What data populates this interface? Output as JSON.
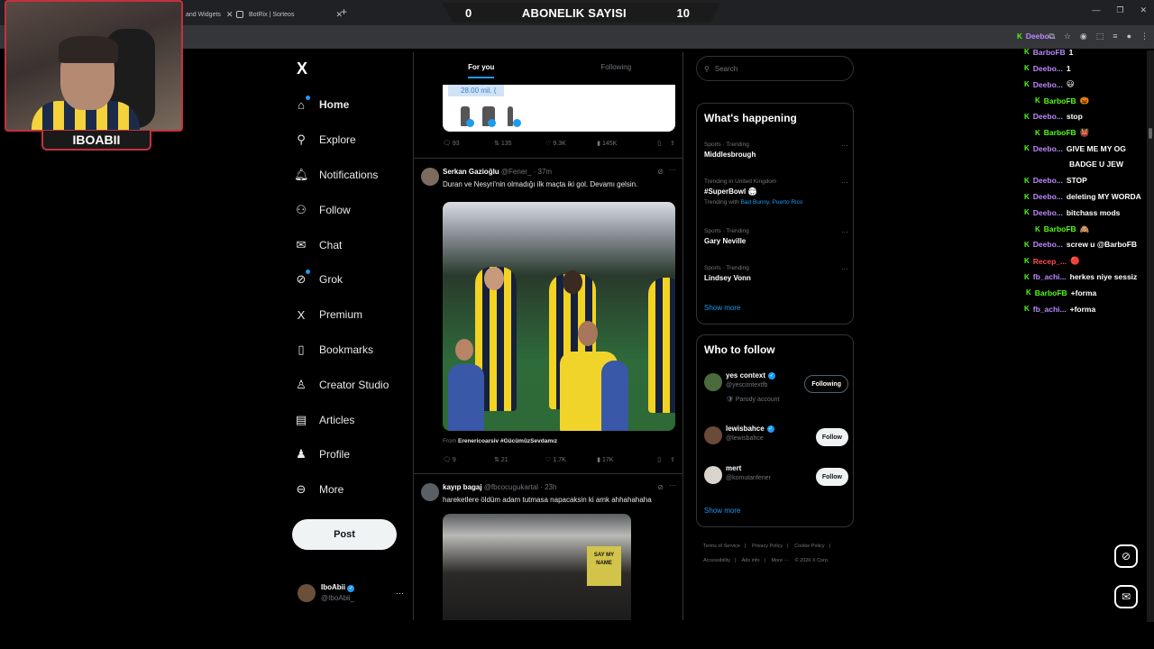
{
  "browser": {
    "tabs": [
      {
        "label": "and Widgets"
      },
      {
        "label": "BotRix | Sorteos"
      }
    ],
    "new_tab": "+"
  },
  "overlay": {
    "left_count": "0",
    "label": "ABONELIK SAYISI",
    "right_count": "10",
    "streamer_name": "IBOABII"
  },
  "nav": {
    "logo": "X",
    "items": [
      {
        "label": "Home",
        "icon": "home-icon"
      },
      {
        "label": "Explore",
        "icon": "search-icon"
      },
      {
        "label": "Notifications",
        "icon": "bell-icon"
      },
      {
        "label": "Follow",
        "icon": "add-user-icon"
      },
      {
        "label": "Chat",
        "icon": "mail-icon"
      },
      {
        "label": "Grok",
        "icon": "grok-icon"
      },
      {
        "label": "Premium",
        "icon": "x-icon"
      },
      {
        "label": "Bookmarks",
        "icon": "bookmark-icon"
      },
      {
        "label": "Creator Studio",
        "icon": "creator-icon"
      },
      {
        "label": "Articles",
        "icon": "articles-icon"
      },
      {
        "label": "Profile",
        "icon": "profile-icon"
      },
      {
        "label": "More",
        "icon": "more-icon"
      }
    ],
    "post_label": "Post",
    "account": {
      "name": "IboAbii",
      "handle": "@IboAbii_"
    }
  },
  "feed": {
    "tabs": [
      "For you",
      "Following"
    ],
    "top_media_pill": "28.00 mil. (",
    "tweet0_stats": {
      "replies": "93",
      "reposts": "135",
      "likes": "9.3K",
      "views": "145K"
    },
    "tweet1": {
      "name": "Serkan Gazioğlu",
      "handle": "@Fener_",
      "time": "· 37m",
      "text": "Duran ve Nesyri'nin olmadığı ilk maçta iki gol. Devamı gelsin.",
      "from_prefix": "From",
      "from_source": "Erenericoarsiv #GücümüzSevdamız",
      "stats": {
        "replies": "9",
        "reposts": "21",
        "likes": "1.7K",
        "views": "17K"
      }
    },
    "tweet2": {
      "name": "kayıp bagaj",
      "handle": "@fbcocugukartal",
      "time": "· 23h",
      "text": "hareketlere öldüm adam tutmasa napacaksin ki amk ahhahahaha",
      "sign_text": "SAY MY NAME"
    }
  },
  "sidebar": {
    "search_placeholder": "Search",
    "happening_title": "What's happening",
    "trends": [
      {
        "category": "Sports · Trending",
        "title": "Middlesbrough",
        "with": ""
      },
      {
        "category": "Trending in United Kingdom",
        "title": "#SuperBowl 🏟",
        "with_prefix": "Trending with",
        "with": "Bad Bunny, Puerto Rico"
      },
      {
        "category": "Sports · Trending",
        "title": "Gary Neville",
        "with": ""
      },
      {
        "category": "Sports · Trending",
        "title": "Lindsey Vonn",
        "with": ""
      }
    ],
    "show_more": "Show more",
    "who_title": "Who to follow",
    "who": [
      {
        "name": "yes context",
        "handle": "@yescontextfb",
        "sub": "🛡 Parody account",
        "button": "Following"
      },
      {
        "name": "lewisbahce",
        "handle": "@lewisbahce",
        "sub": "",
        "button": "Follow"
      },
      {
        "name": "mert",
        "handle": "@komutanfener",
        "sub": "",
        "button": "Follow"
      }
    ],
    "who_show_more": "Show more",
    "footer": [
      "Terms of Service",
      "|",
      "Privacy Policy",
      "|",
      "Cookie Policy",
      "|",
      "Accessibility",
      "|",
      "Ads info",
      "|",
      "More ···",
      "© 2026 X Corp."
    ]
  },
  "chat": [
    {
      "user": "Deebo...",
      "msg": "",
      "color": "#b98bff"
    },
    {
      "user": "BarboFB",
      "msg": "1",
      "color": "#b98bff"
    },
    {
      "user": "Deebo...",
      "msg": "1",
      "color": "#b98bff"
    },
    {
      "user": "Deebo...",
      "msg": "😃",
      "color": "#b98bff"
    },
    {
      "user": "BarboFB",
      "msg": "🎃",
      "color": "#53fc18"
    },
    {
      "user": "Deebo...",
      "msg": "stop",
      "color": "#b98bff"
    },
    {
      "user": "BarboFB",
      "msg": "👹",
      "color": "#53fc18"
    },
    {
      "user": "Deebo...",
      "msg": "GIVE ME MY OG",
      "color": "#b98bff"
    },
    {
      "user": "",
      "msg": "BADGE U JEW",
      "color": "#b98bff"
    },
    {
      "user": "Deebo...",
      "msg": "STOP",
      "color": "#b98bff"
    },
    {
      "user": "Deebo...",
      "msg": "deleting MY WORDA",
      "color": "#b98bff"
    },
    {
      "user": "Deebo...",
      "msg": "bitchass mods",
      "color": "#b98bff"
    },
    {
      "user": "BarboFB",
      "msg": "🙈",
      "color": "#53fc18"
    },
    {
      "user": "Deebo...",
      "msg": "screw u @BarboFB",
      "color": "#b98bff"
    },
    {
      "user": "Recep_...",
      "msg": "🔴",
      "color": "#ff4d4d"
    },
    {
      "user": "fb_achi...",
      "msg": "herkes niye sessiz",
      "color": "#b98bff"
    },
    {
      "user": "BarboFB",
      "msg": "+forma",
      "color": "#53fc18"
    },
    {
      "user": "fb_achi...",
      "msg": "+forma",
      "color": "#b98bff"
    }
  ]
}
